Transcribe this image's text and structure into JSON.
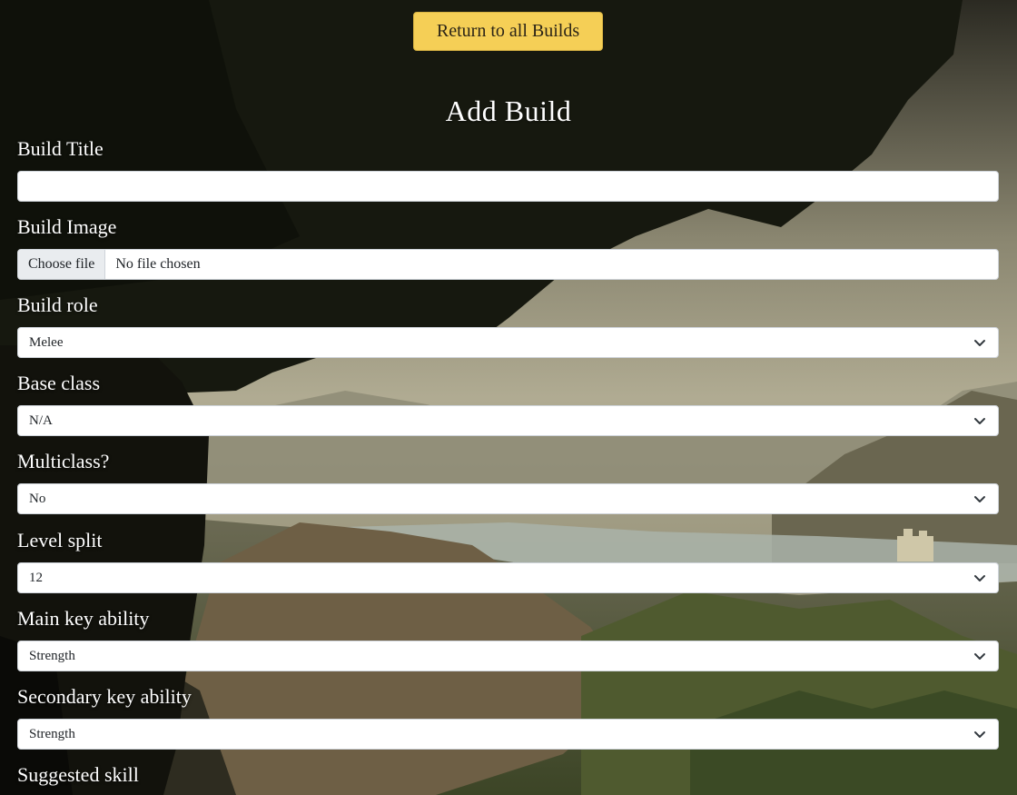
{
  "header": {
    "return_label": "Return to all Builds",
    "title": "Add Build"
  },
  "form": {
    "build_title": {
      "label": "Build Title",
      "value": ""
    },
    "build_image": {
      "label": "Build Image",
      "button_label": "Choose file",
      "status": "No file chosen"
    },
    "build_role": {
      "label": "Build role",
      "value": "Melee"
    },
    "base_class": {
      "label": "Base class",
      "value": "N/A"
    },
    "multiclass": {
      "label": "Multiclass?",
      "value": "No"
    },
    "level_split": {
      "label": "Level split",
      "value": "12"
    },
    "main_key_ability": {
      "label": "Main key ability",
      "value": "Strength"
    },
    "secondary_key_ability": {
      "label": "Secondary key ability",
      "value": "Strength"
    },
    "suggested_skill": {
      "label": "Suggested skill"
    }
  },
  "colors": {
    "button_accent": "#f5cf56",
    "heading_text": "#ffffff"
  },
  "icons": {
    "select_arrow": "chevron-down-icon"
  }
}
